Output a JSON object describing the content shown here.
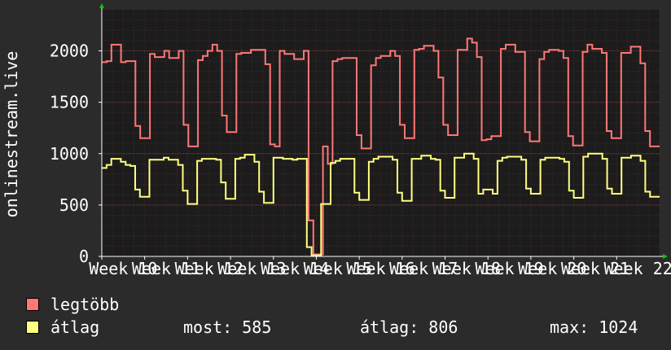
{
  "chart_data": {
    "type": "line",
    "ylabel": "onlinestream.live",
    "ylim": [
      0,
      2400
    ],
    "yticks": [
      0,
      500,
      1000,
      1500,
      2000
    ],
    "xticks": [
      "Week 10",
      "Week 11",
      "Week 12",
      "Week 13",
      "Week 14",
      "Week 15",
      "Week 16",
      "Week 17",
      "Week 18",
      "Week 19",
      "Week 20",
      "Week 21",
      "Week 22"
    ],
    "series": [
      {
        "name": "legtöbb",
        "color": "#ff7777",
        "values": [
          1890,
          1900,
          2060,
          2060,
          1890,
          1900,
          1900,
          1270,
          1150,
          1150,
          1970,
          1940,
          1940,
          2000,
          1930,
          1930,
          2000,
          1280,
          1070,
          1070,
          1910,
          1950,
          2000,
          2060,
          2000,
          1370,
          1210,
          1210,
          1970,
          1980,
          1980,
          2010,
          2010,
          2010,
          1870,
          1090,
          1070,
          2000,
          1970,
          1970,
          1920,
          1920,
          2000,
          350,
          20,
          20,
          1070,
          900,
          1900,
          1920,
          1930,
          1930,
          1930,
          1180,
          1050,
          1050,
          1860,
          1930,
          1950,
          1950,
          2000,
          1950,
          1280,
          1150,
          1150,
          2010,
          2020,
          2050,
          2050,
          2000,
          1740,
          1280,
          1180,
          1180,
          2010,
          2010,
          2120,
          2080,
          1940,
          1130,
          1140,
          1170,
          1170,
          2020,
          2060,
          2060,
          1990,
          1990,
          1210,
          1120,
          1120,
          1920,
          1990,
          2010,
          2010,
          2000,
          1930,
          1170,
          1080,
          1080,
          1990,
          2060,
          2020,
          2020,
          1980,
          1220,
          1150,
          1150,
          1980,
          1980,
          2040,
          2040,
          1880,
          1220,
          1070,
          1070
        ]
      },
      {
        "name": "átlag",
        "color": "#ffff80",
        "values": [
          860,
          890,
          950,
          950,
          920,
          890,
          880,
          650,
          580,
          580,
          940,
          940,
          940,
          960,
          940,
          940,
          890,
          640,
          510,
          510,
          930,
          950,
          950,
          950,
          940,
          720,
          560,
          560,
          950,
          960,
          990,
          990,
          920,
          630,
          520,
          520,
          960,
          960,
          950,
          950,
          940,
          950,
          950,
          90,
          10,
          10,
          510,
          510,
          910,
          930,
          950,
          950,
          950,
          620,
          550,
          550,
          920,
          950,
          970,
          970,
          970,
          940,
          620,
          540,
          540,
          950,
          950,
          980,
          980,
          950,
          940,
          640,
          570,
          570,
          960,
          960,
          1000,
          1000,
          950,
          610,
          650,
          650,
          610,
          930,
          960,
          970,
          970,
          970,
          940,
          660,
          610,
          610,
          940,
          960,
          960,
          960,
          950,
          920,
          640,
          570,
          570,
          970,
          1000,
          1000,
          1000,
          950,
          660,
          610,
          610,
          960,
          960,
          980,
          980,
          930,
          630,
          580,
          580
        ]
      }
    ]
  },
  "legend": [
    {
      "label": "legtöbb",
      "color": "#ff7777"
    },
    {
      "label": "átlag",
      "color": "#ffff80"
    }
  ],
  "stats": {
    "most": "most: 585",
    "atlag": "átlag: 806",
    "max": "max: 1024"
  }
}
